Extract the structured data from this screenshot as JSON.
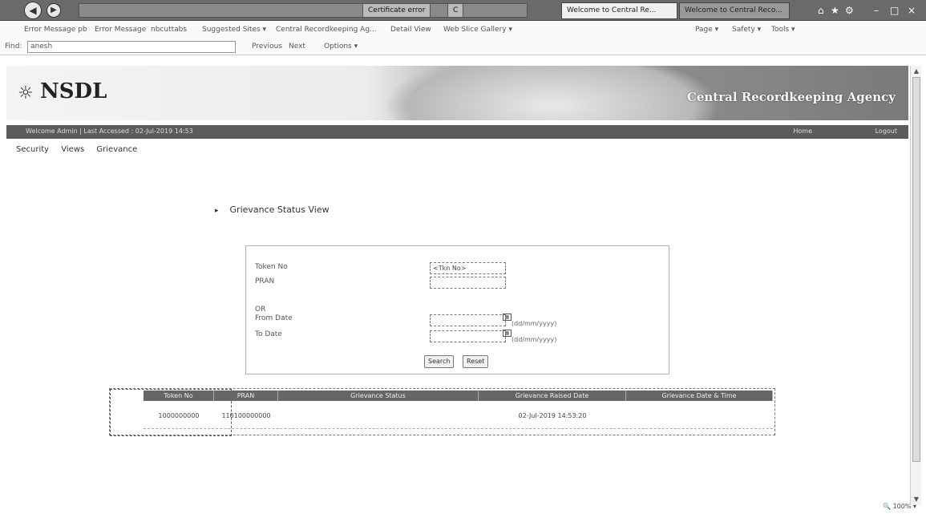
{
  "browser": {
    "address_url": "",
    "address_controls": [
      "Certificate error",
      "C"
    ],
    "tabs": [
      {
        "label": "Welcome to Central Re...",
        "active": true
      },
      {
        "label": "Welcome to Central Reco...",
        "active": false
      }
    ],
    "window_controls": [
      "⌂",
      "★",
      "⚙",
      "–",
      "□",
      "×"
    ]
  },
  "favorites": [
    "Error Message pb",
    "Error Message",
    "nbcuttabs",
    "Suggested Sites ▾",
    "Central Recordkeeping Ag...",
    "Detail View",
    "Web Slice Gallery ▾"
  ],
  "command_bar": [
    "Page ▾",
    "Safety ▾",
    "Tools ▾"
  ],
  "find_bar": {
    "label": "Find:",
    "value": "anesh",
    "previous": "Previous",
    "next": "Next",
    "options": "Options ▾"
  },
  "site": {
    "logo": "NSDL",
    "agency": "Central Recordkeeping Agency",
    "strip_left": "Welcome Admin | Last Accessed : 02-Jul-2019 14:53",
    "strip_right_1": "Home",
    "strip_right_2": "Logout",
    "menu": [
      "Security",
      "Views",
      "Grievance"
    ]
  },
  "page": {
    "heading": "Grievance Status View",
    "form": {
      "token_label": "Token No",
      "token_value": "<Tkn No>",
      "pran_label": "PRAN",
      "pran_value": "",
      "or_label": "OR",
      "from_label": "From Date",
      "to_label": "To Date",
      "date_format": "(dd/mm/yyyy)",
      "search_button": "Search",
      "reset_button": "Reset"
    },
    "table": {
      "headers": [
        "Token No",
        "PRAN",
        "Grievance Status",
        "Grievance Raised Date",
        "Grievance Date & Time"
      ],
      "rows": [
        [
          "1000000000",
          "110100000000",
          "",
          "02-Jul-2019 14:53:20",
          ""
        ]
      ]
    }
  },
  "status": {
    "zoom": "🔍 100%  ▾"
  }
}
